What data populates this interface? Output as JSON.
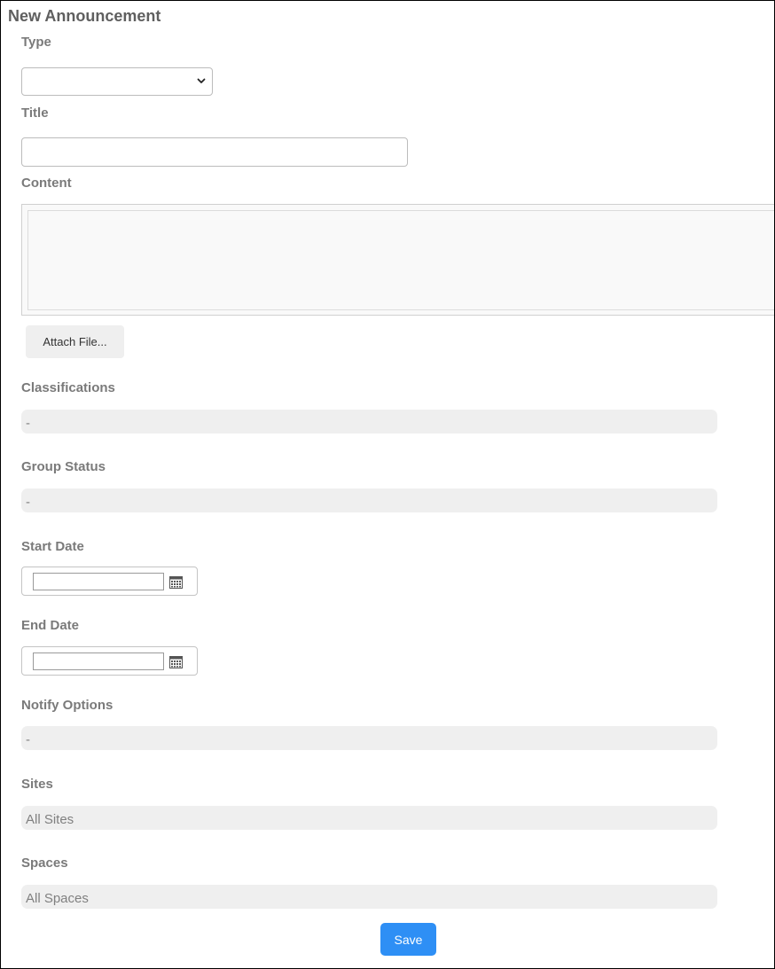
{
  "page": {
    "title": "New Announcement"
  },
  "form": {
    "type": {
      "label": "Type",
      "value": ""
    },
    "title": {
      "label": "Title",
      "value": ""
    },
    "content": {
      "label": "Content",
      "value": ""
    },
    "attach_label": "Attach File...",
    "classifications": {
      "label": "Classifications",
      "value": "-"
    },
    "group_status": {
      "label": "Group Status",
      "value": "-"
    },
    "start_date": {
      "label": "Start Date",
      "value": ""
    },
    "end_date": {
      "label": "End Date",
      "value": ""
    },
    "notify_options": {
      "label": "Notify Options",
      "value": "-"
    },
    "sites": {
      "label": "Sites",
      "value": "All Sites"
    },
    "spaces": {
      "label": "Spaces",
      "value": "All Spaces"
    },
    "save_label": "Save"
  },
  "icons": {
    "select_chevron": "chevron-down-icon",
    "calendar": "calendar-icon"
  },
  "colors": {
    "primary_button": "#2e8ff5",
    "readonly_bg": "#efefef",
    "label_text": "#7a7a7a"
  }
}
